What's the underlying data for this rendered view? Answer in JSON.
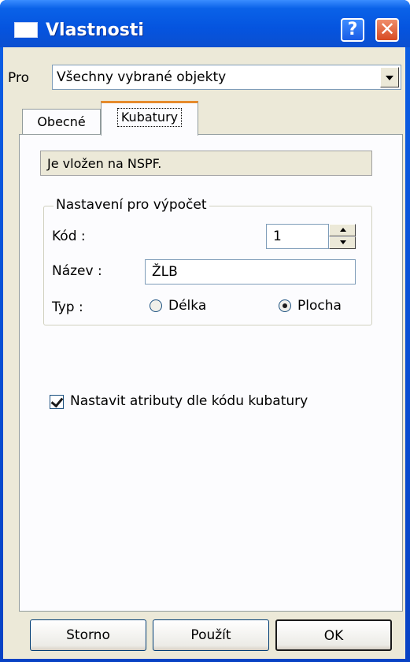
{
  "window": {
    "title": "Vlastnosti",
    "help_glyph": "?",
    "close_glyph": "✕"
  },
  "pro": {
    "label": "Pro",
    "selected": "Všechny vybrané objekty"
  },
  "tabs": [
    {
      "label": "Obecné"
    },
    {
      "label": "Kubatury"
    }
  ],
  "kubatury": {
    "info": "Je vložen na NSPF.",
    "group_title": "Nastavení pro výpočet",
    "kod_label": "Kód :",
    "kod_value": "1",
    "nazev_label": "Název :",
    "nazev_value": "ŽLB",
    "typ_label": "Typ :",
    "radio_delka": "Délka",
    "radio_plocha": "Plocha",
    "selected_type": "Plocha",
    "checkbox_label": "Nastavit atributy dle kódu kubatury",
    "checkbox_checked": true
  },
  "buttons": {
    "storno": "Storno",
    "pouzit": "Použít",
    "ok": "OK"
  },
  "colors": {
    "titlebar": "#0554df",
    "dialog_bg": "#ece9d8",
    "tab_highlight": "#e68b2c",
    "close_button": "#d74a22"
  }
}
